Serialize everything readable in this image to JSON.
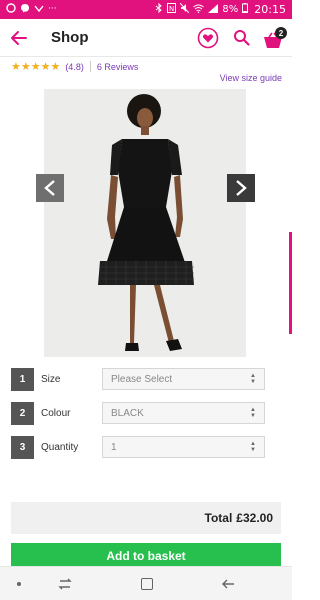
{
  "status_bar": {
    "time": "20:15",
    "battery": "8%",
    "left_icons": [
      "opera-icon",
      "messenger-icon",
      "avatar-icon",
      "more-icon"
    ],
    "right_icons": [
      "bluetooth-icon",
      "nfc-icon",
      "mute-icon",
      "wifi-icon",
      "signal-icon",
      "battery-icon"
    ],
    "more": "···"
  },
  "app_bar": {
    "title": "Shop",
    "basket_count": "2"
  },
  "rating": {
    "stars": "★★★★★",
    "value": "(4.8)",
    "reviews": "6 Reviews"
  },
  "size_guide": "View size guide",
  "options": [
    {
      "num": "1",
      "label": "Size",
      "value": "Please Select"
    },
    {
      "num": "2",
      "label": "Colour",
      "value": "BLACK"
    },
    {
      "num": "3",
      "label": "Quantity",
      "value": "1"
    }
  ],
  "total": {
    "label": "Total",
    "value": "£32.00"
  },
  "add_button": "Add to basket",
  "colors": {
    "brand": "#e1127e",
    "accent_link": "#7b3ab5",
    "add_button": "#27c04f",
    "star": "#f2b01e"
  }
}
